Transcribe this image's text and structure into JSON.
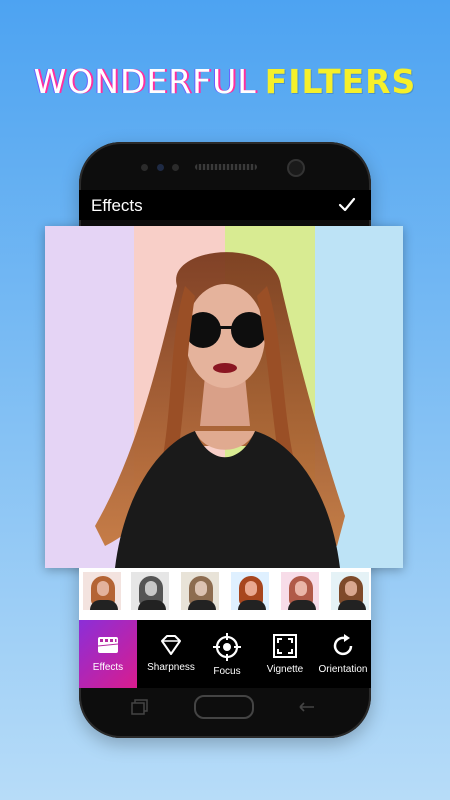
{
  "headline": {
    "part1": "WONDERFUL",
    "part2": "FILTERS"
  },
  "app": {
    "title": "Effects",
    "confirm_icon": "check-icon"
  },
  "filter_strips": [
    "#e5d4f5",
    "#f8cfc8",
    "#d8eb92",
    "#bde3f6"
  ],
  "thumbnails": [
    {
      "tone": "warm"
    },
    {
      "tone": "mono"
    },
    {
      "tone": "faded"
    },
    {
      "tone": "vivid"
    },
    {
      "tone": "pink"
    },
    {
      "tone": "sepia"
    }
  ],
  "tools": [
    {
      "label": "Effects",
      "icon": "film-icon",
      "active": true
    },
    {
      "label": "Sharpness",
      "icon": "diamond-icon",
      "active": false
    },
    {
      "label": "Focus",
      "icon": "crosshair-icon",
      "active": false
    },
    {
      "label": "Vignette",
      "icon": "frame-corners-icon",
      "active": false
    },
    {
      "label": "Orientation",
      "icon": "rotate-icon",
      "active": false
    }
  ],
  "colors": {
    "accent_gradient_start": "#8b2fd8",
    "accent_gradient_end": "#d91c8e",
    "headline_yellow": "#f6f02a"
  }
}
